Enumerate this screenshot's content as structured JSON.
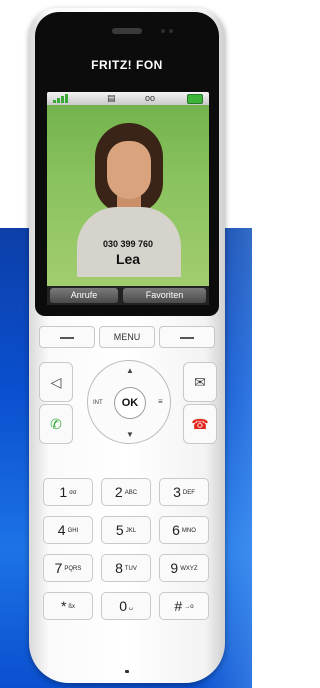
{
  "brand": "FRITZ! FON",
  "screen": {
    "status_icons": [
      "signal-icon",
      "message-icon",
      "voicemail-icon",
      "battery-icon"
    ],
    "caller_number": "030 399 760",
    "caller_name": "Lea",
    "softkeys": [
      "Anrufe",
      "Favoriten"
    ]
  },
  "menu_row": {
    "center_label": "MENU"
  },
  "nav": {
    "ok_label": "OK",
    "left_label": "INT",
    "right_label": "≡"
  },
  "keypad": [
    {
      "digit": "1",
      "letters": "σσ"
    },
    {
      "digit": "2",
      "letters": "ABC"
    },
    {
      "digit": "3",
      "letters": "DEF"
    },
    {
      "digit": "4",
      "letters": "GHI"
    },
    {
      "digit": "5",
      "letters": "JKL"
    },
    {
      "digit": "6",
      "letters": "MNO"
    },
    {
      "digit": "7",
      "letters": "PQRS"
    },
    {
      "digit": "8",
      "letters": "TUV"
    },
    {
      "digit": "9",
      "letters": "WXYZ"
    },
    {
      "digit": "*",
      "letters": "ßx"
    },
    {
      "digit": "0",
      "letters": "␣"
    },
    {
      "digit": "#",
      "letters": "→o"
    }
  ],
  "colors": {
    "call_green": "#2fa935",
    "end_red": "#e2241a",
    "background_blue": "#0a4fcf"
  }
}
